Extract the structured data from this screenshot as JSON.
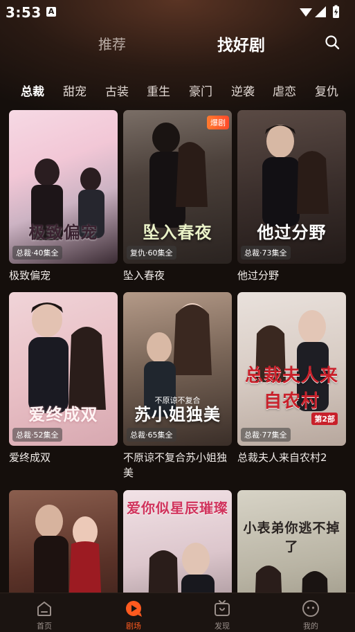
{
  "status": {
    "time": "3:53",
    "notif_letter": "A"
  },
  "top_nav": {
    "tabs": [
      {
        "label": "推荐",
        "active": false
      },
      {
        "label": "找好剧",
        "active": true
      }
    ],
    "search_icon": "search-icon"
  },
  "genres": [
    "总裁",
    "甜宠",
    "古装",
    "重生",
    "豪门",
    "逆袭",
    "虐恋",
    "复仇"
  ],
  "cards": [
    {
      "title": "极致偏宠",
      "badge": "总裁·40集全",
      "art_text": "极致偏宠",
      "hot": ""
    },
    {
      "title": "坠入春夜",
      "badge": "复仇·60集全",
      "art_text": "坠入春夜",
      "hot": "爆剧"
    },
    {
      "title": "他过分野",
      "badge": "总裁·73集全",
      "art_text": "他过分野",
      "hot": ""
    },
    {
      "title": "爱终成双",
      "badge": "总裁·52集全",
      "art_text": "爱终成双",
      "hot": ""
    },
    {
      "title": "不原谅不复合苏小姐独美",
      "badge": "总裁·65集全",
      "art_text": "苏小姐独美",
      "art_sub": "不原谅不复合",
      "hot": ""
    },
    {
      "title": "总裁夫人来自农村2",
      "badge": "总裁·77集全",
      "art_text": "总裁夫人来自农村",
      "art_sub": "第2部",
      "hot": ""
    },
    {
      "title": "",
      "badge": "",
      "art_text": "",
      "hot": ""
    },
    {
      "title": "",
      "badge": "",
      "art_text": "爱你似星辰璀璨",
      "hot": ""
    },
    {
      "title": "",
      "badge": "",
      "art_text": "小表弟你逃不掉了",
      "hot": ""
    }
  ],
  "bottom_nav": [
    {
      "label": "首页",
      "icon": "home-icon",
      "active": false
    },
    {
      "label": "剧场",
      "icon": "theater-icon",
      "active": true
    },
    {
      "label": "发现",
      "icon": "tv-icon",
      "active": false
    },
    {
      "label": "我的",
      "icon": "profile-icon",
      "active": false
    }
  ],
  "colors": {
    "accent": "#ff5a1f",
    "background": "#150f0c"
  }
}
